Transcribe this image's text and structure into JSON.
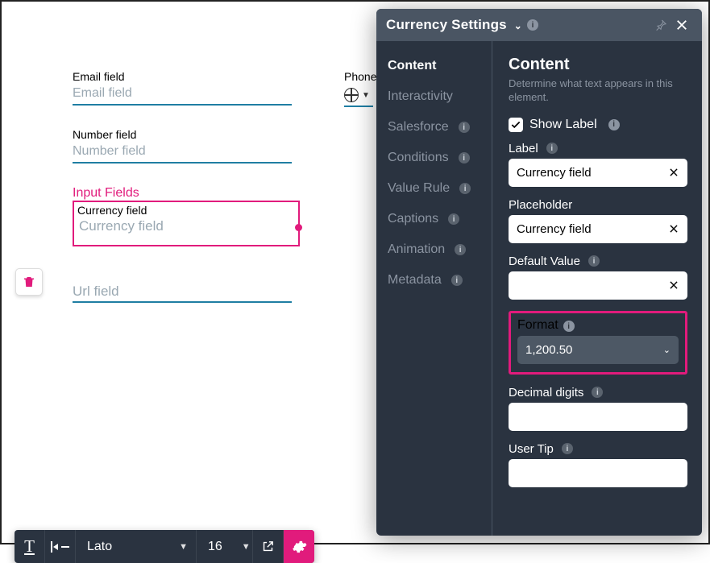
{
  "canvas": {
    "email": {
      "label": "Email field",
      "placeholder": "Email field"
    },
    "number": {
      "label": "Number field",
      "placeholder": "Number field"
    },
    "phone": {
      "label": "Phone"
    },
    "section_title": "Input Fields",
    "currency": {
      "label": "Currency field",
      "placeholder": "Currency field"
    },
    "url": {
      "placeholder": "Url field"
    }
  },
  "toolbar": {
    "font": "Lato",
    "size": "16"
  },
  "panel": {
    "title": "Currency Settings",
    "tabs": {
      "content": "Content",
      "interactivity": "Interactivity",
      "salesforce": "Salesforce",
      "conditions": "Conditions",
      "value_rule": "Value Rule",
      "captions": "Captions",
      "animation": "Animation",
      "metadata": "Metadata"
    },
    "content": {
      "heading": "Content",
      "description": "Determine what text appears in this element.",
      "show_label": "Show Label",
      "label": {
        "title": "Label",
        "value": "Currency field"
      },
      "placeholder": {
        "title": "Placeholder",
        "value": "Currency field"
      },
      "default_value": {
        "title": "Default Value",
        "value": ""
      },
      "format": {
        "title": "Format",
        "value": "1,200.50"
      },
      "decimal_digits": {
        "title": "Decimal digits",
        "value": ""
      },
      "user_tip": {
        "title": "User Tip",
        "value": ""
      }
    }
  }
}
